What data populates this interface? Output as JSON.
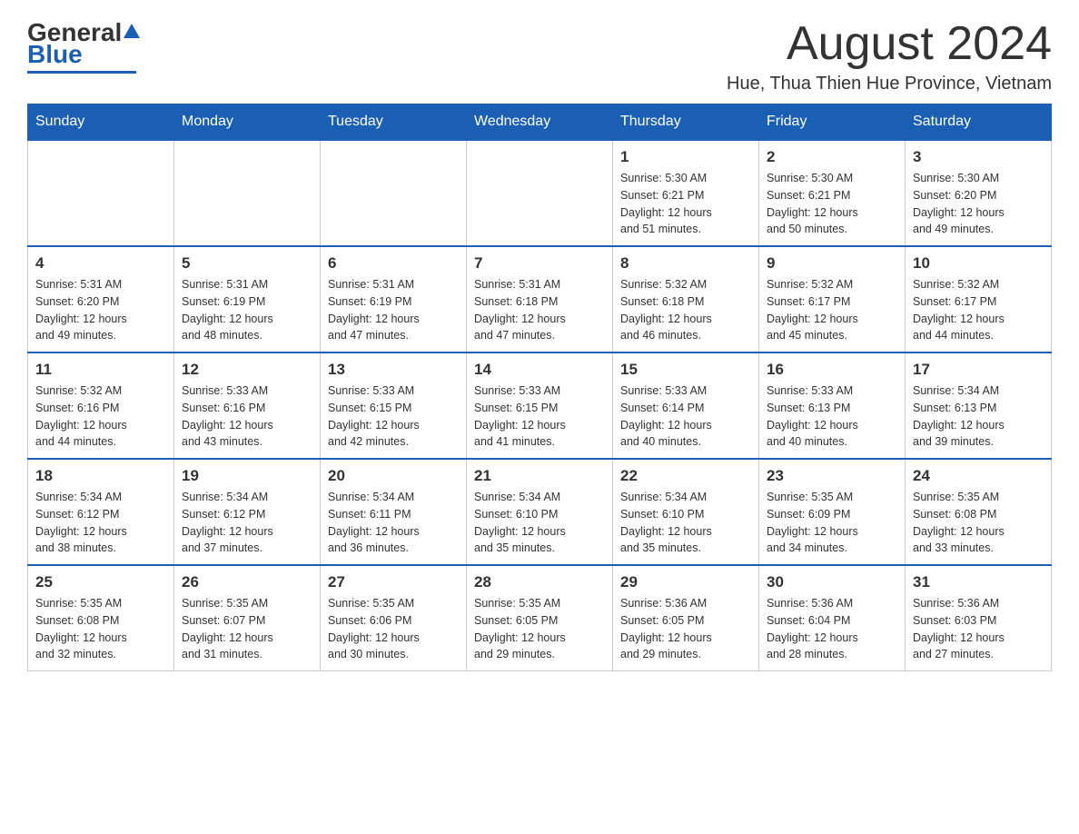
{
  "header": {
    "logo_general": "General",
    "logo_blue": "Blue",
    "month_title": "August 2024",
    "location": "Hue, Thua Thien Hue Province, Vietnam"
  },
  "days_of_week": [
    "Sunday",
    "Monday",
    "Tuesday",
    "Wednesday",
    "Thursday",
    "Friday",
    "Saturday"
  ],
  "weeks": [
    {
      "cells": [
        {
          "day": "",
          "info": ""
        },
        {
          "day": "",
          "info": ""
        },
        {
          "day": "",
          "info": ""
        },
        {
          "day": "",
          "info": ""
        },
        {
          "day": "1",
          "info": "Sunrise: 5:30 AM\nSunset: 6:21 PM\nDaylight: 12 hours\nand 51 minutes."
        },
        {
          "day": "2",
          "info": "Sunrise: 5:30 AM\nSunset: 6:21 PM\nDaylight: 12 hours\nand 50 minutes."
        },
        {
          "day": "3",
          "info": "Sunrise: 5:30 AM\nSunset: 6:20 PM\nDaylight: 12 hours\nand 49 minutes."
        }
      ]
    },
    {
      "cells": [
        {
          "day": "4",
          "info": "Sunrise: 5:31 AM\nSunset: 6:20 PM\nDaylight: 12 hours\nand 49 minutes."
        },
        {
          "day": "5",
          "info": "Sunrise: 5:31 AM\nSunset: 6:19 PM\nDaylight: 12 hours\nand 48 minutes."
        },
        {
          "day": "6",
          "info": "Sunrise: 5:31 AM\nSunset: 6:19 PM\nDaylight: 12 hours\nand 47 minutes."
        },
        {
          "day": "7",
          "info": "Sunrise: 5:31 AM\nSunset: 6:18 PM\nDaylight: 12 hours\nand 47 minutes."
        },
        {
          "day": "8",
          "info": "Sunrise: 5:32 AM\nSunset: 6:18 PM\nDaylight: 12 hours\nand 46 minutes."
        },
        {
          "day": "9",
          "info": "Sunrise: 5:32 AM\nSunset: 6:17 PM\nDaylight: 12 hours\nand 45 minutes."
        },
        {
          "day": "10",
          "info": "Sunrise: 5:32 AM\nSunset: 6:17 PM\nDaylight: 12 hours\nand 44 minutes."
        }
      ]
    },
    {
      "cells": [
        {
          "day": "11",
          "info": "Sunrise: 5:32 AM\nSunset: 6:16 PM\nDaylight: 12 hours\nand 44 minutes."
        },
        {
          "day": "12",
          "info": "Sunrise: 5:33 AM\nSunset: 6:16 PM\nDaylight: 12 hours\nand 43 minutes."
        },
        {
          "day": "13",
          "info": "Sunrise: 5:33 AM\nSunset: 6:15 PM\nDaylight: 12 hours\nand 42 minutes."
        },
        {
          "day": "14",
          "info": "Sunrise: 5:33 AM\nSunset: 6:15 PM\nDaylight: 12 hours\nand 41 minutes."
        },
        {
          "day": "15",
          "info": "Sunrise: 5:33 AM\nSunset: 6:14 PM\nDaylight: 12 hours\nand 40 minutes."
        },
        {
          "day": "16",
          "info": "Sunrise: 5:33 AM\nSunset: 6:13 PM\nDaylight: 12 hours\nand 40 minutes."
        },
        {
          "day": "17",
          "info": "Sunrise: 5:34 AM\nSunset: 6:13 PM\nDaylight: 12 hours\nand 39 minutes."
        }
      ]
    },
    {
      "cells": [
        {
          "day": "18",
          "info": "Sunrise: 5:34 AM\nSunset: 6:12 PM\nDaylight: 12 hours\nand 38 minutes."
        },
        {
          "day": "19",
          "info": "Sunrise: 5:34 AM\nSunset: 6:12 PM\nDaylight: 12 hours\nand 37 minutes."
        },
        {
          "day": "20",
          "info": "Sunrise: 5:34 AM\nSunset: 6:11 PM\nDaylight: 12 hours\nand 36 minutes."
        },
        {
          "day": "21",
          "info": "Sunrise: 5:34 AM\nSunset: 6:10 PM\nDaylight: 12 hours\nand 35 minutes."
        },
        {
          "day": "22",
          "info": "Sunrise: 5:34 AM\nSunset: 6:10 PM\nDaylight: 12 hours\nand 35 minutes."
        },
        {
          "day": "23",
          "info": "Sunrise: 5:35 AM\nSunset: 6:09 PM\nDaylight: 12 hours\nand 34 minutes."
        },
        {
          "day": "24",
          "info": "Sunrise: 5:35 AM\nSunset: 6:08 PM\nDaylight: 12 hours\nand 33 minutes."
        }
      ]
    },
    {
      "cells": [
        {
          "day": "25",
          "info": "Sunrise: 5:35 AM\nSunset: 6:08 PM\nDaylight: 12 hours\nand 32 minutes."
        },
        {
          "day": "26",
          "info": "Sunrise: 5:35 AM\nSunset: 6:07 PM\nDaylight: 12 hours\nand 31 minutes."
        },
        {
          "day": "27",
          "info": "Sunrise: 5:35 AM\nSunset: 6:06 PM\nDaylight: 12 hours\nand 30 minutes."
        },
        {
          "day": "28",
          "info": "Sunrise: 5:35 AM\nSunset: 6:05 PM\nDaylight: 12 hours\nand 29 minutes."
        },
        {
          "day": "29",
          "info": "Sunrise: 5:36 AM\nSunset: 6:05 PM\nDaylight: 12 hours\nand 29 minutes."
        },
        {
          "day": "30",
          "info": "Sunrise: 5:36 AM\nSunset: 6:04 PM\nDaylight: 12 hours\nand 28 minutes."
        },
        {
          "day": "31",
          "info": "Sunrise: 5:36 AM\nSunset: 6:03 PM\nDaylight: 12 hours\nand 27 minutes."
        }
      ]
    }
  ]
}
